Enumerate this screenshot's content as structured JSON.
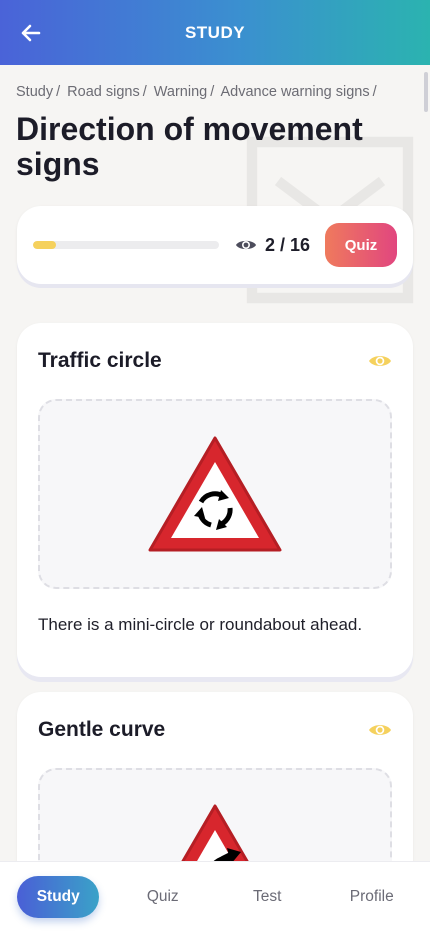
{
  "header": {
    "title": "STUDY"
  },
  "breadcrumb": [
    "Study",
    "Road signs",
    "Warning",
    "Advance warning signs"
  ],
  "page_title": "Direction of movement signs",
  "progress": {
    "seen": 2,
    "total": 16,
    "count_text": "2 / 16",
    "fraction": 0.125,
    "quiz_label": "Quiz"
  },
  "cards": [
    {
      "title": "Traffic circle",
      "description": "There is a mini-circle or roundabout ahead."
    },
    {
      "title": "Gentle curve",
      "description": ""
    }
  ],
  "bottom_nav": [
    {
      "label": "Study",
      "active": true
    },
    {
      "label": "Quiz",
      "active": false
    },
    {
      "label": "Test",
      "active": false
    },
    {
      "label": "Profile",
      "active": false
    }
  ],
  "colors": {
    "accent_yellow": "#f5d15d",
    "quiz_gradient_start": "#ef7a5d",
    "quiz_gradient_end": "#e1467f",
    "header_start": "#4a63d8",
    "header_end": "#2bb3b0"
  }
}
